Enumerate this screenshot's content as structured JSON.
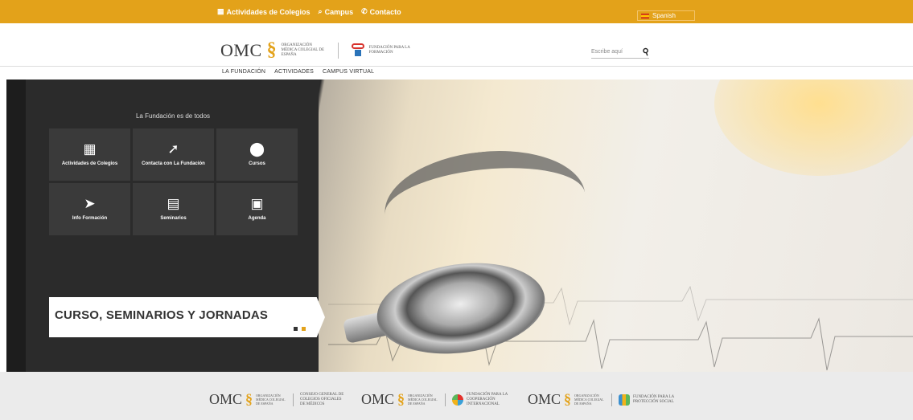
{
  "topbar": {
    "links": [
      "Actividades de Colegios",
      "Campus",
      "Contacto"
    ],
    "language": "Spanish",
    "color": "#e3a21a"
  },
  "header": {
    "logo_text": "OMC",
    "logo_org": "ORGANIZACIÓN MÉDICA COLEGIAL DE ESPAÑA",
    "foundation": "FUNDACIÓN PARA LA FORMACIÓN",
    "search_placeholder": "Escribe aquí"
  },
  "nav": {
    "items": [
      "LA FUNDACIÓN",
      "ACTIVIDADES",
      "CAMPUS VIRTUAL"
    ]
  },
  "hero": {
    "section_title": "La Fundación es de todos",
    "tiles": [
      {
        "label": "Actividades de Colegios",
        "icon": "calendar-grid-icon"
      },
      {
        "label": "Contacta con La Fundación",
        "icon": "cursor-click-icon"
      },
      {
        "label": "Cursos",
        "icon": "map-pin-icon"
      },
      {
        "label": "Info Formación",
        "icon": "paper-plane-icon"
      },
      {
        "label": "Seminarios",
        "icon": "certificate-icon"
      },
      {
        "label": "Agenda",
        "icon": "calendar-icon"
      }
    ],
    "banner": "CURSO, SEMINARIOS Y JORNADAS"
  },
  "footer": {
    "logos": [
      {
        "omc": "OMC",
        "org": "ORGANIZACIÓN MÉDICA COLEGIAL DE ESPAÑA",
        "partner": "CONSEJO GENERAL DE COLEGIOS OFICIALES DE MÉDICOS"
      },
      {
        "omc": "OMC",
        "org": "ORGANIZACIÓN MÉDICA COLEGIAL DE ESPAÑA",
        "partner": "FUNDACIÓN PARA LA COOPERACIÓN INTERNACIONAL"
      },
      {
        "omc": "OMC",
        "org": "ORGANIZACIÓN MÉDICA COLEGIAL DE ESPAÑA",
        "partner": "FUNDACIÓN PARA LA PROTECCIÓN SOCIAL"
      }
    ]
  }
}
